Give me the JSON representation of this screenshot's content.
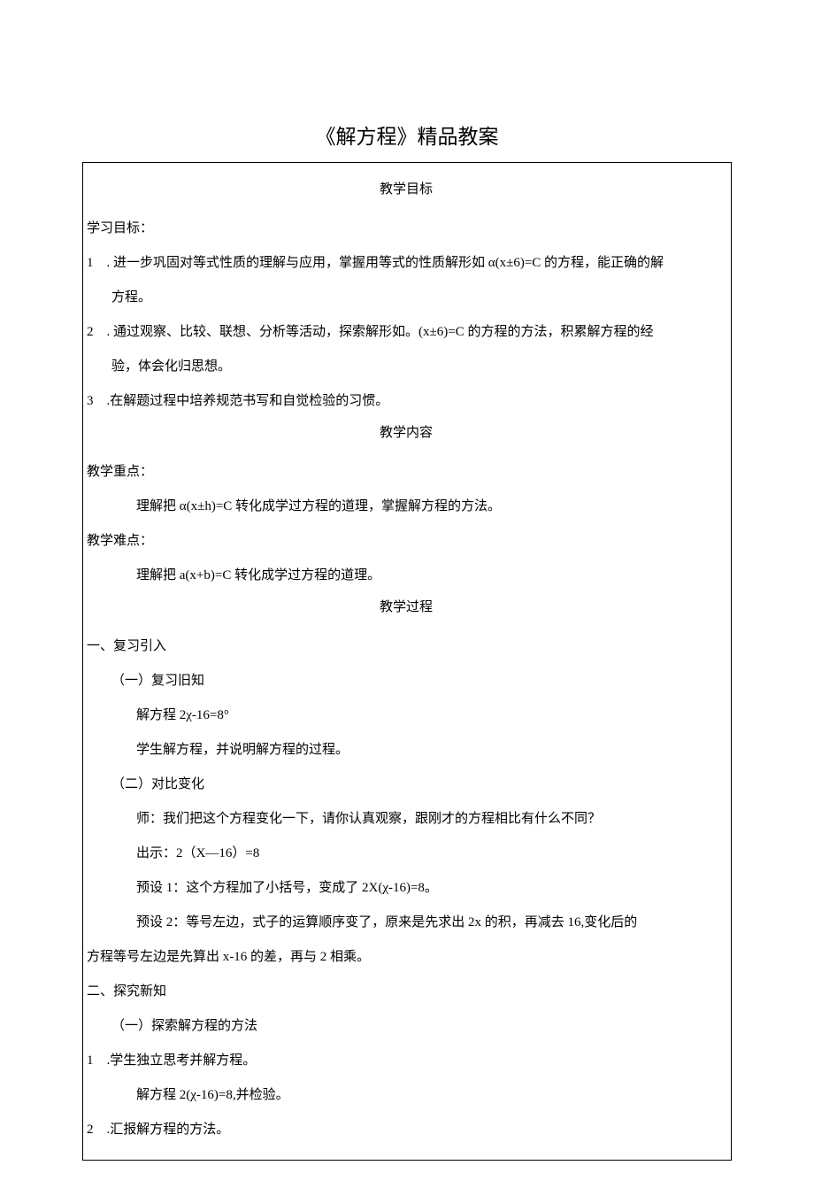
{
  "title": "《解方程》精品教案",
  "sections": {
    "goal_header": "教学目标",
    "goal_label": "学习目标：",
    "goal_items": [
      "1 . 进一步巩固对等式性质的理解与应用，掌握用等式的性质解形如 α(x±6)=C 的方程，能正确的解",
      "方程。",
      "2 . 通过观察、比较、联想、分析等活动，探索解形如。(x±6)=C 的方程的方法，积累解方程的经",
      "验，体会化归思想。",
      "3 .在解题过程中培养规范书写和自觉检验的习惯。"
    ],
    "content_header": "教学内容",
    "key_label": "教学重点：",
    "key_text": "理解把 α(x±h)=C 转化成学过方程的道理，掌握解方程的方法。",
    "hard_label": "教学难点：",
    "hard_text": "理解把 a(x+b)=C 转化成学过方程的道理。",
    "process_header": "教学过程",
    "p1": "一、复习引入",
    "p1a": "（一）复习旧知",
    "p1a1": "解方程 2χ-16=8°",
    "p1a2": "学生解方程，并说明解方程的过程。",
    "p1b": "（二）对比变化",
    "p1b1": "师：我们把这个方程变化一下，请你认真观察，跟刚才的方程相比有什么不同？",
    "p1b2": "出示：2（X—16）=8",
    "p1b3": "预设 1：这个方程加了小括号，变成了 2X(χ-16)=8。",
    "p1b4": "预设 2：等号左边，式子的运算顺序变了，原来是先求出 2x 的积，再减去 16,变化后的",
    "p1b4b": "方程等号左边是先算出 x-16 的差，再与 2 相乘。",
    "p2": "二、探究新知",
    "p2a": "（一）探索解方程的方法",
    "p2a1": "1 .学生独立思考并解方程。",
    "p2a1b": "解方程 2(χ-16)=8,并检验。",
    "p2a2": "2 .汇报解方程的方法。"
  }
}
